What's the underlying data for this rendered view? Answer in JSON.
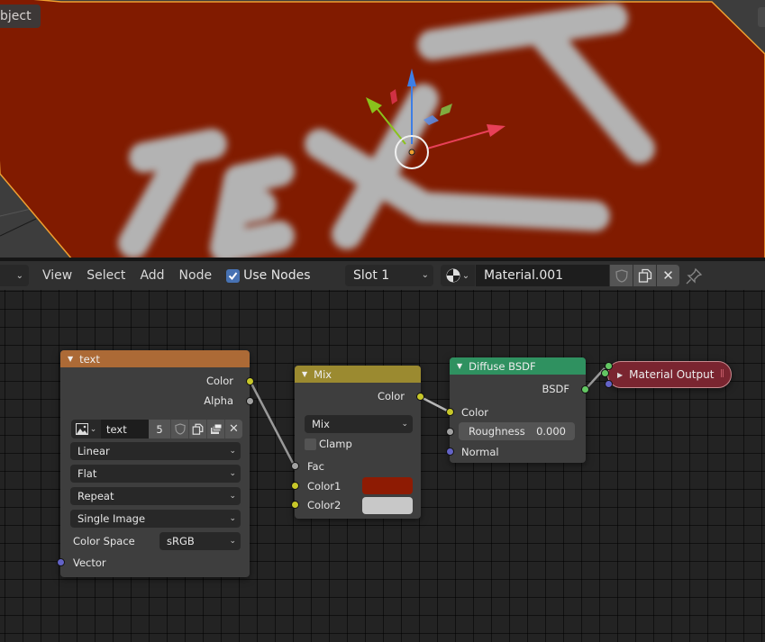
{
  "viewport": {
    "mode_label": "bject",
    "plane_color": "#811b00",
    "texture_text": "TEXT",
    "texture_text_color": "#b0b0b0"
  },
  "header": {
    "editor_type_icon": "chevron-down-icon",
    "menus": [
      "View",
      "Select",
      "Add",
      "Node"
    ],
    "use_nodes": {
      "label": "Use Nodes",
      "checked": true
    },
    "slot": {
      "value": "Slot 1"
    },
    "material": {
      "name": "Material.001",
      "browse_icon": "material-sphere-icon"
    },
    "buttons": {
      "fake_user": "shield-icon",
      "duplicate": "duplicate-icon",
      "unlink": "✕",
      "pin": "pin-icon"
    }
  },
  "nodes": {
    "image_texture": {
      "title": "text",
      "header_color": "#ac6a36",
      "outputs": [
        "Color",
        "Alpha"
      ],
      "image_name": "text",
      "users": "5",
      "unlink": "✕",
      "interpolation": "Linear",
      "projection": "Flat",
      "extension": "Repeat",
      "source": "Single Image",
      "color_space_label": "Color Space",
      "color_space": "sRGB",
      "inputs": [
        "Vector"
      ]
    },
    "mix": {
      "title": "Mix",
      "header_color": "#9b8a30",
      "output": "Color",
      "blend_type": "Mix",
      "clamp_label": "Clamp",
      "clamp": false,
      "inputs": [
        "Fac",
        "Color1",
        "Color2"
      ],
      "color1": "#8e1b03",
      "color2": "#c8c8c8"
    },
    "diffuse": {
      "title": "Diffuse BSDF",
      "header_color": "#2f9160",
      "output": "BSDF",
      "inputs": [
        "Color",
        "Normal"
      ],
      "roughness_label": "Roughness",
      "roughness": "0.000"
    },
    "output": {
      "title": "Material Output",
      "collapsed": true
    }
  },
  "gizmo": {
    "x_color": "#e84058",
    "y_color": "#8ac21c",
    "z_color": "#3d7ee6"
  }
}
